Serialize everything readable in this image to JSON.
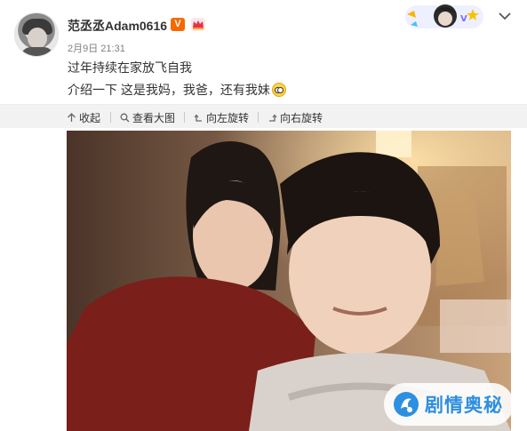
{
  "post": {
    "username": "范丞丞Adam0616",
    "vip_badge": "V",
    "timestamp": "2月9日 21:31",
    "text_line1": "过年持续在家放飞自我",
    "text_line2": "介绍一下 这是我妈，我爸，还有我妹"
  },
  "toolbar": {
    "collapse_label": "收起",
    "view_large_label": "查看大图",
    "rotate_left_label": "向左旋转",
    "rotate_right_label": "向右旋转"
  },
  "icons": {
    "collapse": "arrow-up-icon",
    "view_large": "magnifier-icon",
    "rotate_left": "rotate-left-icon",
    "rotate_right": "rotate-right-icon",
    "more": "chevron-down-icon",
    "emoji": "glasses-emoji-icon",
    "vip": "vip-v-icon",
    "crown": "crown-icon"
  },
  "watermark": {
    "text": "剧情奥秘"
  },
  "colors": {
    "vip_badge": "#f56a00",
    "toolbar_bg": "#f2f2f2",
    "watermark_text": "#2e8fe0"
  }
}
